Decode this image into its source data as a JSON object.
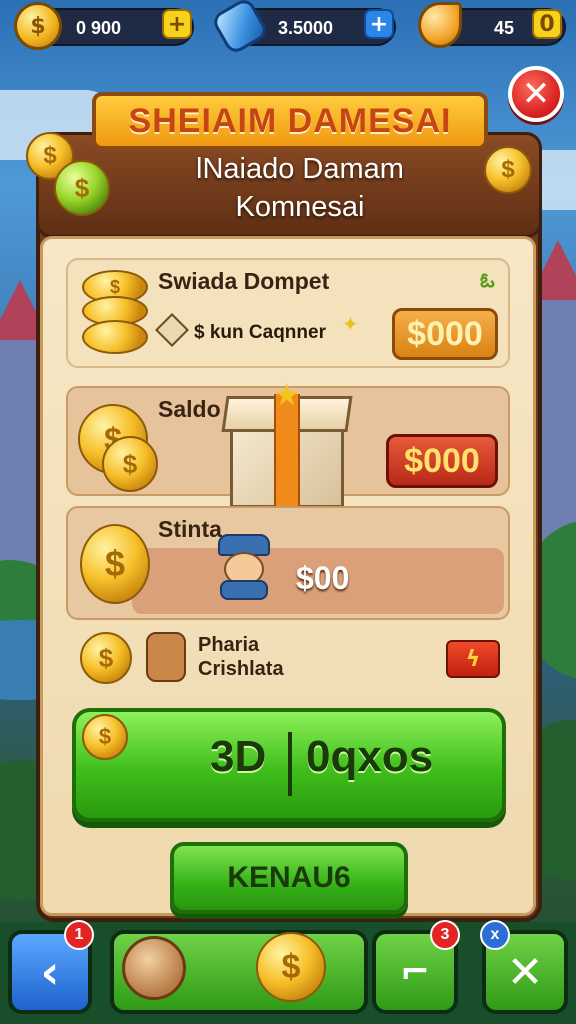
{
  "top_bar": {
    "coins": {
      "value": "0 900",
      "icon": "coin-icon"
    },
    "gems": {
      "value": "3.5000",
      "icon": "gem-icon"
    },
    "energy": {
      "value": "45",
      "icon": "leaf-icon"
    }
  },
  "header": {
    "title": "SHEIAIM DAMESAI",
    "subtitle_line1": "lNaiado Damam",
    "subtitle_line2": "Komnesai"
  },
  "cards": {
    "wallet": {
      "title": "Swiada Dompet",
      "sub_label": "$ kun Caqnner",
      "price": "$000"
    },
    "saldo": {
      "title": "Saldo",
      "price": "$000"
    },
    "stinta": {
      "title": "Stinta",
      "price": "$00"
    },
    "pharia": {
      "line1": "Pharia",
      "line2": "Crishlata"
    }
  },
  "main_button": {
    "left": "3D",
    "right": "0qxos"
  },
  "secondary_button": {
    "label": "KENAU6"
  },
  "bottom_nav": {
    "back_badge": "1",
    "shovel_badge": "3",
    "close_badge": "x"
  },
  "colors": {
    "accent_green": "#3fbe1b",
    "title_orange": "#f09a12",
    "close_red": "#d41d1d"
  }
}
